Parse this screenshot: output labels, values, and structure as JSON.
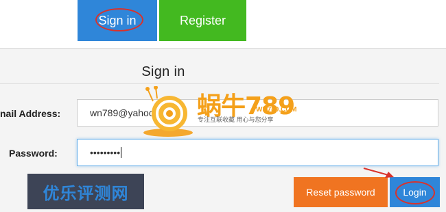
{
  "tabs": {
    "signin_label": "Sign in",
    "register_label": "Register"
  },
  "form": {
    "title": "Sign in",
    "email_label": "nail Address:",
    "email_value": "wn789@yahoo.com",
    "password_label": "Password:",
    "password_value": "•••••••••"
  },
  "buttons": {
    "reset_label": "Reset password",
    "login_label": "Login"
  },
  "watermark": {
    "text": "优乐评测网"
  },
  "logo": {
    "main": "蜗牛789",
    "url": "WN789.COM",
    "slogan": "专注互联收藏    用心与您分享"
  },
  "colors": {
    "tab_signin": "#2f86d9",
    "tab_register": "#43b920",
    "reset": "#f07421",
    "login": "#2f86d9",
    "annotation": "#d9322b"
  }
}
